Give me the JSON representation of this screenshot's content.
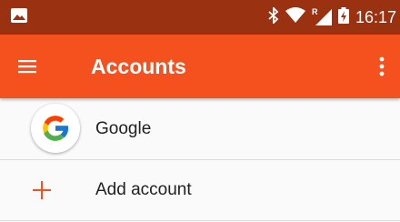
{
  "status_bar": {
    "time": "16:17",
    "roaming_indicator": "R",
    "icons": [
      "image-notification-icon",
      "bluetooth-icon",
      "wifi-icon",
      "cell-signal-icon",
      "battery-charging-icon"
    ]
  },
  "app_bar": {
    "title": "Accounts",
    "menu_icon": "hamburger-menu-icon",
    "overflow_icon": "more-vert-icon",
    "color": "#f4511e"
  },
  "accounts": {
    "items": [
      {
        "label": "Google",
        "icon": "google-logo-icon"
      }
    ],
    "add_account_label": "Add account",
    "add_icon": "plus-icon"
  },
  "colors": {
    "accent": "#f4511e",
    "status_bar": "#9a3111"
  }
}
